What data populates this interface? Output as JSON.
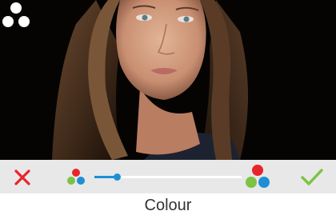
{
  "screen": {
    "settings_icon": "three-dots-icon",
    "toolbar": {
      "cancel_icon": "close-icon",
      "confirm_icon": "checkmark-icon",
      "low_icon": "colour-low-icon",
      "high_icon": "colour-high-icon",
      "slider_value": 0.15
    }
  },
  "caption": "Colour",
  "colors": {
    "cancel": "#e8242b",
    "confirm": "#7cc243",
    "slider": "#1e8fd6",
    "dot_red": "#e8242b",
    "dot_green": "#7cc243",
    "dot_blue": "#1e8fd6"
  }
}
